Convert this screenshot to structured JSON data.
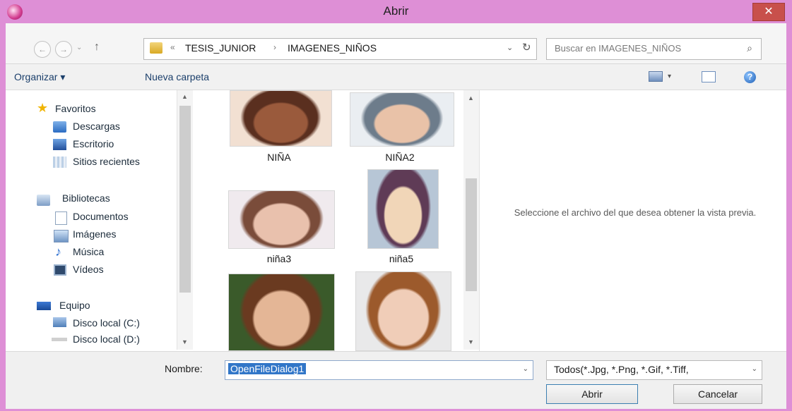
{
  "window": {
    "title": "Abrir",
    "close": "✕"
  },
  "nav": {
    "back": "←",
    "forward": "→",
    "dropdown": "⌄",
    "up": "↑"
  },
  "address": {
    "overflow": "«",
    "crumbs": [
      "TESIS_JUNIOR",
      "IMAGENES_NIÑOS"
    ],
    "separator": "›",
    "dropdown": "⌄",
    "refresh": "↻"
  },
  "search": {
    "placeholder": "Buscar en IMAGENES_NIÑOS",
    "icon": "⌕"
  },
  "toolbar": {
    "organize": "Organizar ▾",
    "new_folder": "Nueva carpeta",
    "view_dropdown": "▾",
    "help": "?"
  },
  "sidebar": {
    "favorites": "Favoritos",
    "favorites_items": [
      "Descargas",
      "Escritorio",
      "Sitios recientes"
    ],
    "libraries": "Bibliotecas",
    "libraries_items": [
      "Documentos",
      "Imágenes",
      "Música",
      "Vídeos"
    ],
    "computer": "Equipo",
    "computer_items": [
      "Disco local (C:)",
      "Disco local (D:)"
    ]
  },
  "files": [
    {
      "name": "NIÑA",
      "colors": [
        "#f2e0d2",
        "#9a5a3c",
        "#5a2f1f"
      ]
    },
    {
      "name": "NIÑA2",
      "colors": [
        "#eaeef2",
        "#e9c2a8",
        "#6d7c8b"
      ]
    },
    {
      "name": "niña3",
      "colors": [
        "#f0eaee",
        "#e9c1ad",
        "#7a4c3a"
      ]
    },
    {
      "name": "niña5",
      "colors": [
        "#b7c6d6",
        "#f1d6b8",
        "#5f3b56"
      ]
    },
    {
      "name": "",
      "colors": [
        "#3a5a2a",
        "#e4b696",
        "#6a3a20"
      ]
    },
    {
      "name": "",
      "colors": [
        "#e9e9ea",
        "#f0cdb8",
        "#9c5a2c"
      ]
    }
  ],
  "preview": {
    "message": "Seleccione el archivo del que desea obtener la vista previa."
  },
  "bottom": {
    "name_label": "Nombre:",
    "name_value": "OpenFileDialog1",
    "filter": "Todos(*.Jpg, *.Png, *.Gif, *.Tiff,",
    "open": "Abrir",
    "cancel": "Cancelar",
    "dropdown": "⌄"
  }
}
